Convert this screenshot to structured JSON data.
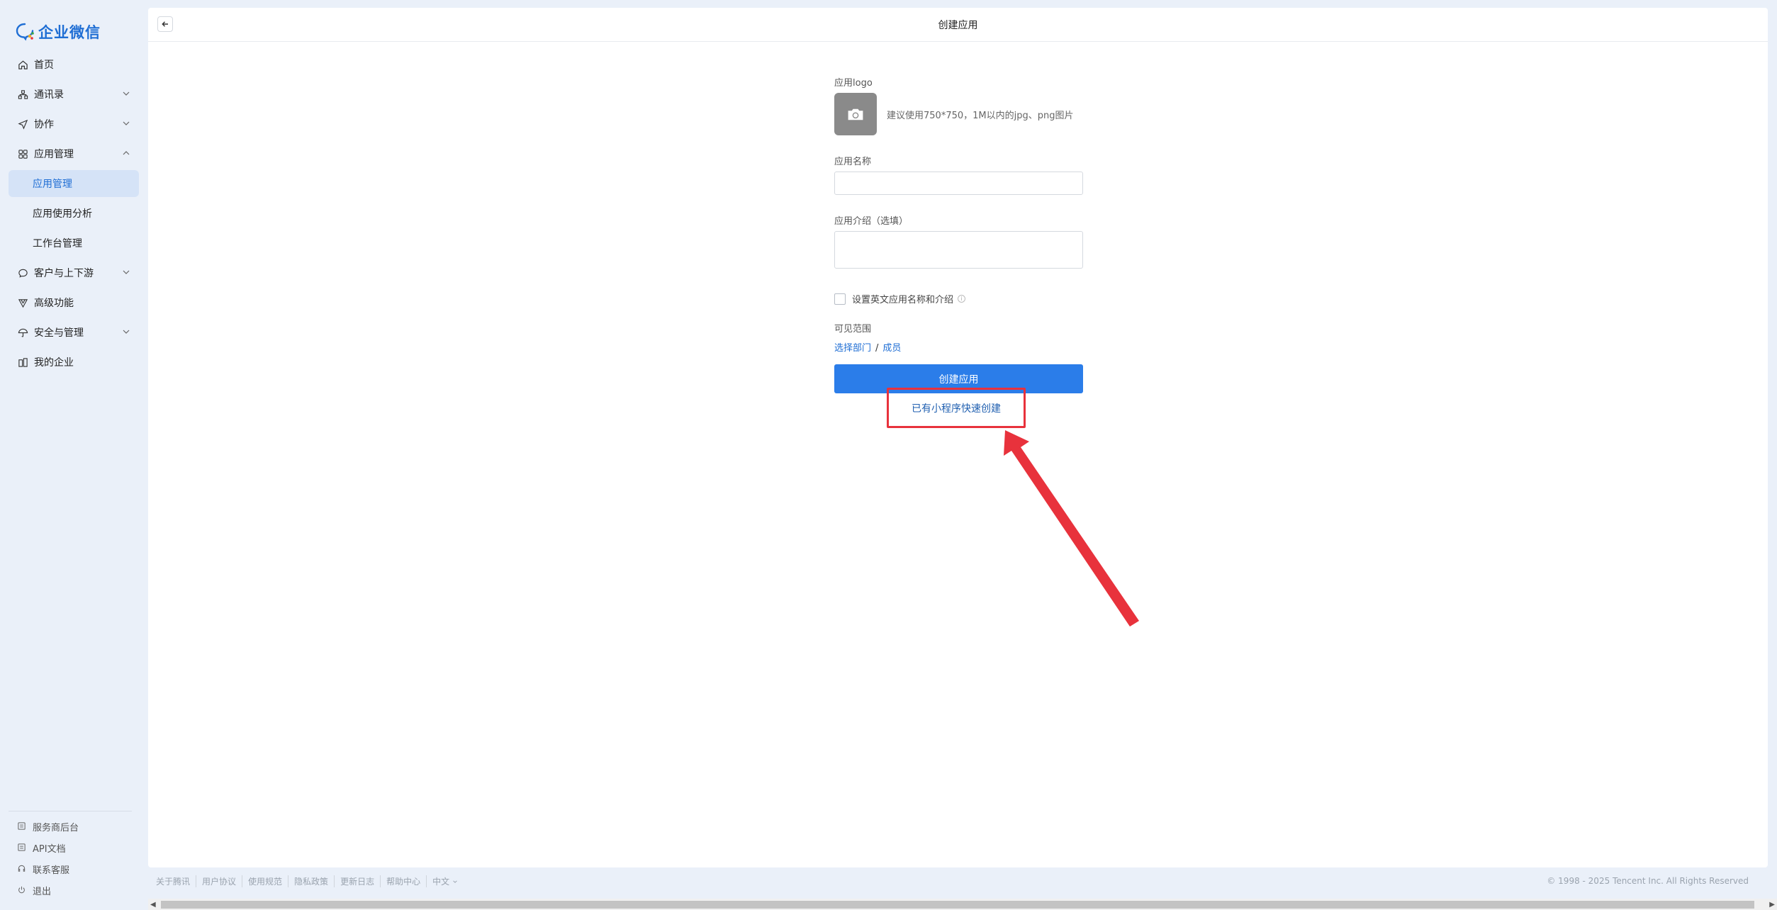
{
  "brand": {
    "name": "企业微信"
  },
  "sidebar": {
    "items": [
      {
        "label": "首页",
        "icon": "home-icon"
      },
      {
        "label": "通讯录",
        "icon": "org-icon",
        "expandable": true
      },
      {
        "label": "协作",
        "icon": "send-icon",
        "expandable": true
      },
      {
        "label": "应用管理",
        "icon": "grid-icon",
        "expanded": true
      },
      {
        "label": "应用管理",
        "sub": true,
        "active": true
      },
      {
        "label": "应用使用分析",
        "sub": true
      },
      {
        "label": "工作台管理",
        "sub": true
      },
      {
        "label": "客户与上下游",
        "icon": "chat-icon",
        "expandable": true
      },
      {
        "label": "高级功能",
        "icon": "flag-icon"
      },
      {
        "label": "安全与管理",
        "icon": "umbrella-icon",
        "expandable": true
      },
      {
        "label": "我的企业",
        "icon": "building-icon"
      }
    ],
    "bottom": [
      {
        "label": "服务商后台",
        "icon": "doc-icon"
      },
      {
        "label": "API文档",
        "icon": "doc-icon"
      },
      {
        "label": "联系客服",
        "icon": "headset-icon"
      },
      {
        "label": "退出",
        "icon": "power-icon"
      }
    ]
  },
  "header": {
    "title": "创建应用"
  },
  "form": {
    "logo_label": "应用logo",
    "logo_hint": "建议使用750*750，1M以内的jpg、png图片",
    "name_label": "应用名称",
    "name_value": "",
    "intro_label": "应用介绍（选填）",
    "intro_value": "",
    "english_checkbox_label": "设置英文应用名称和介绍",
    "scope_label": "可见范围",
    "scope_dept": "选择部门",
    "scope_sep": "/",
    "scope_member": "成员",
    "create_button": "创建应用",
    "quick_create_link": "已有小程序快速创建"
  },
  "footer": {
    "links": [
      "关于腾讯",
      "用户协议",
      "使用规范",
      "隐私政策",
      "更新日志",
      "帮助中心"
    ],
    "language": "中文",
    "copyright": "© 1998 - 2025 Tencent Inc. All Rights Reserved"
  },
  "colors": {
    "accent": "#2b7de9",
    "highlight": "#e8323c",
    "sidebar_bg": "#eaf0f9"
  }
}
